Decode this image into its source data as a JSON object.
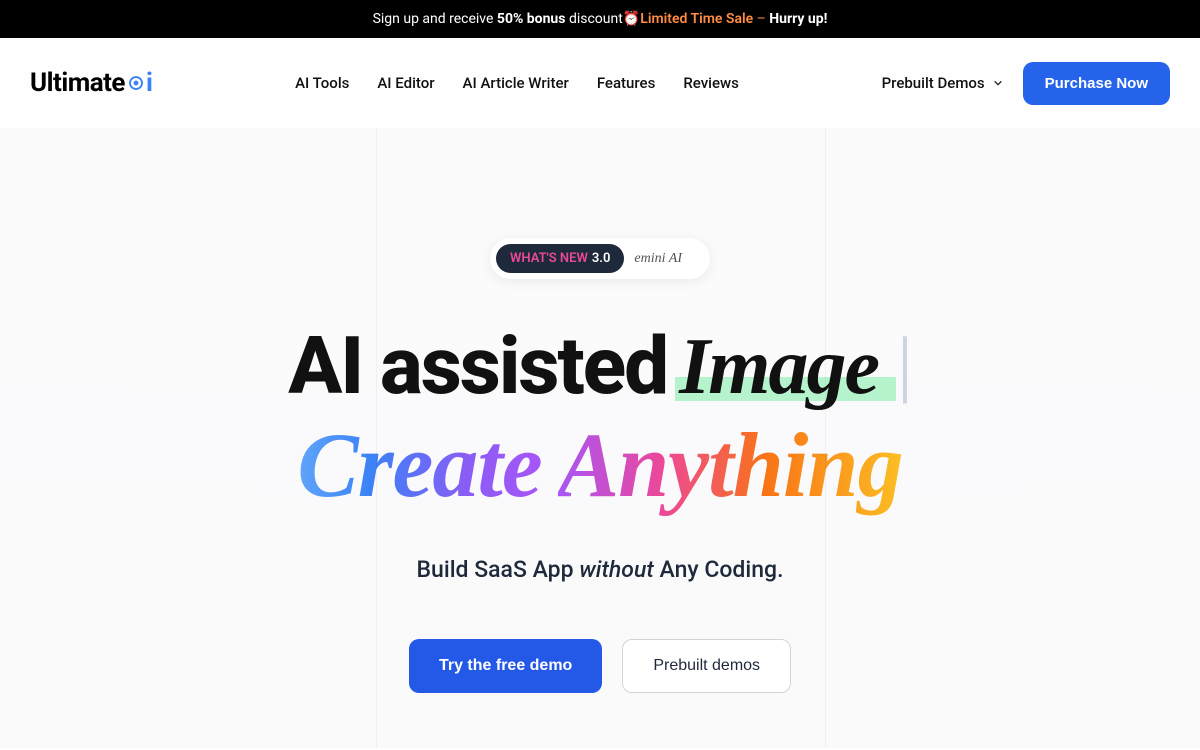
{
  "banner": {
    "prefix": "Sign up and receive ",
    "bonus": "50% bonus",
    "discount": " discount",
    "emoji": "⏰",
    "sale": "Limited Time Sale",
    "dash": " – ",
    "hurry": "Hurry up!"
  },
  "logo": {
    "text": "Ultimate",
    "ai": "i"
  },
  "nav": {
    "items": [
      "AI Tools",
      "AI Editor",
      "AI Article Writer",
      "Features",
      "Reviews"
    ]
  },
  "header": {
    "prebuilt": "Prebuilt Demos",
    "purchase": "Purchase Now"
  },
  "whatsNew": {
    "label": "WHAT'S NEW",
    "version": "3.0",
    "text": "emini AI"
  },
  "hero": {
    "line1a": "AI assisted",
    "line1b": "Image",
    "cursor": "|",
    "line2a": "Create",
    "line2b": "Anything",
    "sub1": "Build SaaS App ",
    "sub2": "without",
    "sub3": " Any Coding."
  },
  "cta": {
    "primary": "Try the free demo",
    "secondary": "Prebuilt demos"
  }
}
